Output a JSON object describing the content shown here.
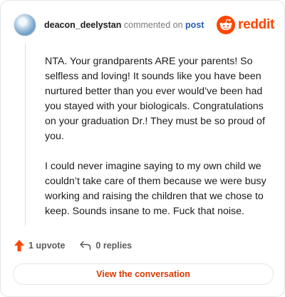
{
  "header": {
    "username": "deacon_deelystan",
    "commented_text": "commented on",
    "post_link": "post",
    "brand_name": "reddit"
  },
  "comment": {
    "paragraphs": [
      "NTA. Your grandparents ARE your parents! So selfless and loving! It sounds like you have been nurtured better than you ever would’ve been had you stayed with your biologicals. Congratulations on your graduation Dr.! They must be so proud of you.",
      "I could never imagine saying to my own child we couldn’t take care of them because we were busy working and raising the children that we chose to keep. Sounds insane to me. Fuck that noise."
    ]
  },
  "actions": {
    "upvote_label": "1 upvote",
    "replies_label": "0 replies",
    "upvote_icon": "upvote-arrow-icon",
    "reply_icon": "reply-arrow-icon"
  },
  "cta": {
    "label": "View the conversation"
  },
  "colors": {
    "brand": "#ff4500",
    "link": "#2a5db0",
    "cta_text": "#d93a00",
    "muted": "#7c7c7c"
  }
}
